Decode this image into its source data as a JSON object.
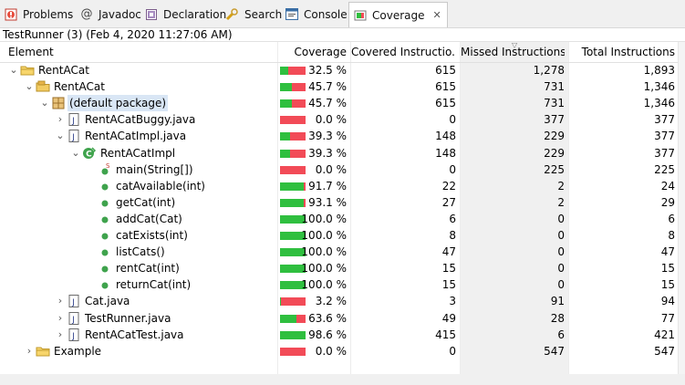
{
  "tabs": [
    {
      "label": "Problems",
      "icon": "problems-icon"
    },
    {
      "label": "Javadoc",
      "icon": "javadoc-icon"
    },
    {
      "label": "Declaration",
      "icon": "declaration-icon"
    },
    {
      "label": "Search",
      "icon": "search-icon"
    },
    {
      "label": "Console",
      "icon": "console-icon"
    },
    {
      "label": "Coverage",
      "icon": "coverage-icon",
      "active": true
    }
  ],
  "session": "TestRunner (3) (Feb 4, 2020 11:27:06 AM)",
  "columns": {
    "element": "Element",
    "coverage": "Coverage",
    "covered": "Covered Instructio...",
    "missed": "Missed Instructions",
    "total": "Total Instructions"
  },
  "colors": {
    "covered": "#2fbf3f",
    "missed": "#f24b57",
    "selection": "#d9e6f5"
  },
  "rows": [
    {
      "name": "RentACat",
      "icon": "project-icon",
      "expander": "expanded",
      "coverage": "32.5 %",
      "cov_fraction": 0.325,
      "covered": "615",
      "missed": "1,278",
      "total": "1,893"
    },
    {
      "name": "RentACat",
      "icon": "source-folder-icon",
      "expander": "expanded",
      "coverage": "45.7 %",
      "cov_fraction": 0.457,
      "covered": "615",
      "missed": "731",
      "total": "1,346"
    },
    {
      "name": "(default package)",
      "icon": "package-icon",
      "expander": "expanded",
      "selected": true,
      "coverage": "45.7 %",
      "cov_fraction": 0.457,
      "covered": "615",
      "missed": "731",
      "total": "1,346"
    },
    {
      "name": "RentACatBuggy.java",
      "icon": "java-file-icon",
      "expander": "collapsed",
      "coverage": "0.0 %",
      "cov_fraction": 0.0,
      "covered": "0",
      "missed": "377",
      "total": "377"
    },
    {
      "name": "RentACatImpl.java",
      "icon": "java-file-icon",
      "expander": "expanded",
      "coverage": "39.3 %",
      "cov_fraction": 0.393,
      "covered": "148",
      "missed": "229",
      "total": "377"
    },
    {
      "name": "RentACatImpl",
      "icon": "class-icon",
      "expander": "expanded",
      "coverage": "39.3 %",
      "cov_fraction": 0.393,
      "covered": "148",
      "missed": "229",
      "total": "377"
    },
    {
      "name": "main(String[])",
      "icon": "static-method-icon",
      "expander": "none",
      "coverage": "0.0 %",
      "cov_fraction": 0.0,
      "covered": "0",
      "missed": "225",
      "total": "225"
    },
    {
      "name": "catAvailable(int)",
      "icon": "method-icon",
      "expander": "none",
      "coverage": "91.7 %",
      "cov_fraction": 0.917,
      "covered": "22",
      "missed": "2",
      "total": "24"
    },
    {
      "name": "getCat(int)",
      "icon": "method-icon",
      "expander": "none",
      "coverage": "93.1 %",
      "cov_fraction": 0.931,
      "covered": "27",
      "missed": "2",
      "total": "29"
    },
    {
      "name": "addCat(Cat)",
      "icon": "method-icon",
      "expander": "none",
      "coverage": "100.0 %",
      "cov_fraction": 1.0,
      "covered": "6",
      "missed": "0",
      "total": "6"
    },
    {
      "name": "catExists(int)",
      "icon": "method-icon",
      "expander": "none",
      "coverage": "100.0 %",
      "cov_fraction": 1.0,
      "covered": "8",
      "missed": "0",
      "total": "8"
    },
    {
      "name": "listCats()",
      "icon": "method-icon",
      "expander": "none",
      "coverage": "100.0 %",
      "cov_fraction": 1.0,
      "covered": "47",
      "missed": "0",
      "total": "47"
    },
    {
      "name": "rentCat(int)",
      "icon": "method-icon",
      "expander": "none",
      "coverage": "100.0 %",
      "cov_fraction": 1.0,
      "covered": "15",
      "missed": "0",
      "total": "15"
    },
    {
      "name": "returnCat(int)",
      "icon": "method-icon",
      "expander": "none",
      "coverage": "100.0 %",
      "cov_fraction": 1.0,
      "covered": "15",
      "missed": "0",
      "total": "15"
    },
    {
      "name": "Cat.java",
      "icon": "java-file-icon",
      "expander": "collapsed",
      "coverage": "3.2 %",
      "cov_fraction": 0.032,
      "covered": "3",
      "missed": "91",
      "total": "94"
    },
    {
      "name": "TestRunner.java",
      "icon": "java-file-icon",
      "expander": "collapsed",
      "coverage": "63.6 %",
      "cov_fraction": 0.636,
      "covered": "49",
      "missed": "28",
      "total": "77"
    },
    {
      "name": "RentACatTest.java",
      "icon": "java-file-icon",
      "expander": "collapsed",
      "coverage": "98.6 %",
      "cov_fraction": 0.986,
      "covered": "415",
      "missed": "6",
      "total": "421"
    },
    {
      "name": "Example",
      "icon": "project-icon",
      "expander": "collapsed",
      "coverage": "0.0 %",
      "cov_fraction": 0.0,
      "covered": "0",
      "missed": "547",
      "total": "547"
    }
  ]
}
